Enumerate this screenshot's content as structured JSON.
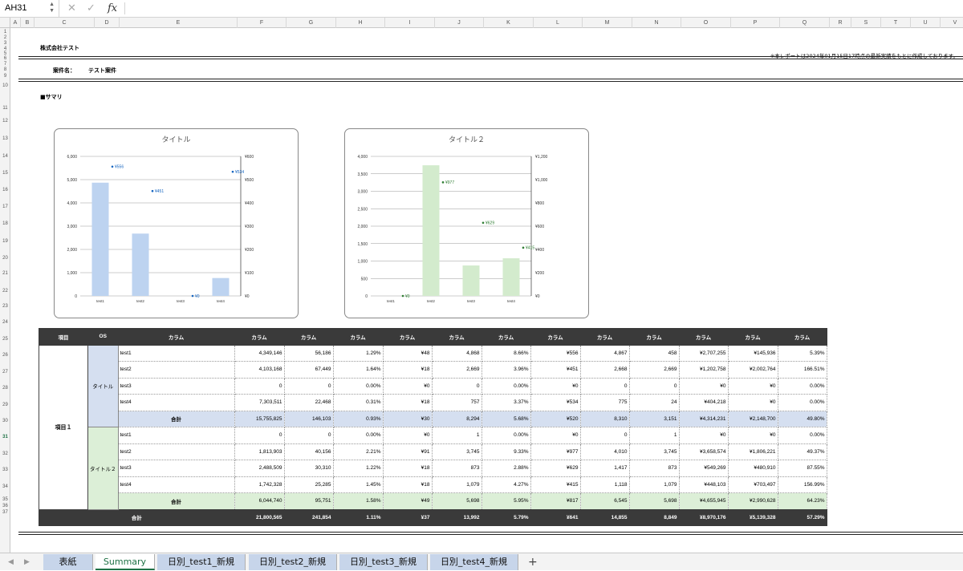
{
  "name_box": "AH31",
  "columns": [
    "A",
    "B",
    "C",
    "D",
    "E",
    "F",
    "G",
    "H",
    "I",
    "J",
    "K",
    "L",
    "M",
    "N",
    "O",
    "P",
    "Q",
    "R",
    "S",
    "T",
    "U",
    "V"
  ],
  "rows": [
    "1",
    "2",
    "3",
    "4",
    "5",
    "6",
    "7",
    "8",
    "9",
    "10",
    "11",
    "12",
    "13",
    "14",
    "15",
    "16",
    "17",
    "18",
    "19",
    "20",
    "21",
    "22",
    "23",
    "24",
    "25",
    "26",
    "27",
    "28",
    "29",
    "30",
    "31",
    "32",
    "33",
    "34",
    "35",
    "36",
    "37"
  ],
  "header": {
    "company": "株式会社テスト",
    "note": "※本レポートは2024年01月15日17時点の最新実績をもとに作成しております。",
    "case_label": "案件名：",
    "case_value": "テスト案件",
    "section": "■サマリ"
  },
  "chart_data": [
    {
      "type": "bar",
      "title": "タイトル",
      "categories": [
        "test1",
        "test2",
        "test3",
        "test4"
      ],
      "series": [
        {
          "values": [
            4870,
            2680,
            0,
            770
          ]
        },
        {
          "values": [
            556,
            451,
            0,
            534
          ],
          "labels": [
            "¥556",
            "¥451",
            "¥0",
            "¥534"
          ]
        }
      ],
      "ylim": [
        0,
        6000
      ],
      "yticks": [
        "0",
        "1,000",
        "2,000",
        "3,000",
        "4,000",
        "5,000",
        "6,000"
      ],
      "y2lim": [
        0,
        600
      ],
      "y2ticks": [
        "¥0",
        "¥100",
        "¥200",
        "¥300",
        "¥400",
        "¥500",
        "¥600"
      ],
      "bar_color": "#bdd3f0",
      "point_color": "#1565c0"
    },
    {
      "type": "bar",
      "title": "タイトル２",
      "categories": [
        "test1",
        "test2",
        "test3",
        "test4"
      ],
      "series": [
        {
          "values": [
            0,
            3745,
            873,
            1079
          ]
        },
        {
          "values": [
            0,
            977,
            629,
            415
          ],
          "labels": [
            "¥0",
            "¥977",
            "¥629",
            "¥415"
          ]
        }
      ],
      "ylim": [
        0,
        4000
      ],
      "yticks": [
        "0",
        "500",
        "1,000",
        "1,500",
        "2,000",
        "2,500",
        "3,000",
        "3,500",
        "4,000"
      ],
      "y2lim": [
        0,
        1200
      ],
      "y2ticks": [
        "¥0",
        "¥200",
        "¥400",
        "¥600",
        "¥800",
        "¥1,000",
        "¥1,200"
      ],
      "bar_color": "#d3ebcd",
      "point_color": "#2e7d32"
    }
  ],
  "table": {
    "headers": [
      "項目",
      "OS",
      "カラム",
      "カラム",
      "カラム",
      "カラム",
      "カラム",
      "カラム",
      "カラム",
      "カラム",
      "カラム",
      "カラム",
      "カラム",
      "カラム",
      "カラム"
    ],
    "item_label": "項目１",
    "groups": [
      {
        "os": "タイトル",
        "color": "blue",
        "rows": [
          {
            "name": "test1",
            "values": [
              "4,349,146",
              "56,186",
              "1.29%",
              "¥48",
              "4,868",
              "8.66%",
              "¥556",
              "4,867",
              "458",
              "¥2,707,255",
              "¥145,936",
              "5.39%"
            ]
          },
          {
            "name": "test2",
            "values": [
              "4,103,168",
              "67,449",
              "1.64%",
              "¥18",
              "2,669",
              "3.96%",
              "¥451",
              "2,668",
              "2,669",
              "¥1,202,758",
              "¥2,002,764",
              "166.51%"
            ]
          },
          {
            "name": "test3",
            "values": [
              "0",
              "0",
              "0.00%",
              "¥0",
              "0",
              "0.00%",
              "¥0",
              "0",
              "0",
              "¥0",
              "¥0",
              "0.00%"
            ]
          },
          {
            "name": "test4",
            "values": [
              "7,303,511",
              "22,468",
              "0.31%",
              "¥18",
              "757",
              "3.37%",
              "¥534",
              "775",
              "24",
              "¥404,218",
              "¥0",
              "0.00%"
            ]
          }
        ],
        "subtotal": {
          "label": "合計",
          "values": [
            "15,755,825",
            "146,103",
            "0.93%",
            "¥30",
            "8,294",
            "5.68%",
            "¥520",
            "8,310",
            "3,151",
            "¥4,314,231",
            "¥2,148,700",
            "49.80%"
          ]
        }
      },
      {
        "os": "タイトル２",
        "color": "green",
        "rows": [
          {
            "name": "test1",
            "values": [
              "0",
              "0",
              "0.00%",
              "¥0",
              "1",
              "0.00%",
              "¥0",
              "0",
              "1",
              "¥0",
              "¥0",
              "0.00%"
            ]
          },
          {
            "name": "test2",
            "values": [
              "1,813,903",
              "40,156",
              "2.21%",
              "¥91",
              "3,745",
              "9.33%",
              "¥977",
              "4,010",
              "3,745",
              "¥3,658,574",
              "¥1,806,221",
              "49.37%"
            ]
          },
          {
            "name": "test3",
            "values": [
              "2,488,509",
              "30,310",
              "1.22%",
              "¥18",
              "873",
              "2.88%",
              "¥629",
              "1,417",
              "873",
              "¥549,269",
              "¥480,910",
              "87.55%"
            ]
          },
          {
            "name": "test4",
            "values": [
              "1,742,328",
              "25,285",
              "1.45%",
              "¥18",
              "1,079",
              "4.27%",
              "¥415",
              "1,118",
              "1,079",
              "¥448,103",
              "¥703,497",
              "156.99%"
            ]
          }
        ],
        "subtotal": {
          "label": "合計",
          "values": [
            "6,044,740",
            "95,751",
            "1.58%",
            "¥49",
            "5,698",
            "5.95%",
            "¥817",
            "6,545",
            "5,698",
            "¥4,655,945",
            "¥2,990,628",
            "64.23%"
          ]
        }
      }
    ],
    "grand_total": {
      "label": "合計",
      "values": [
        "21,800,565",
        "241,854",
        "1.11%",
        "¥37",
        "13,992",
        "5.79%",
        "¥641",
        "14,855",
        "8,849",
        "¥8,970,176",
        "¥5,139,328",
        "57.29%"
      ]
    }
  },
  "tabs": [
    "表紙",
    "Summary",
    "日別_test1_新規",
    "日別_test2_新規",
    "日別_test3_新規",
    "日別_test4_新規"
  ],
  "active_tab": "Summary",
  "colors": {
    "header_dark": "#3a3a3a",
    "blue_fill": "#d5dff0",
    "green_fill": "#dcefd7",
    "accent": "#1e7145"
  }
}
